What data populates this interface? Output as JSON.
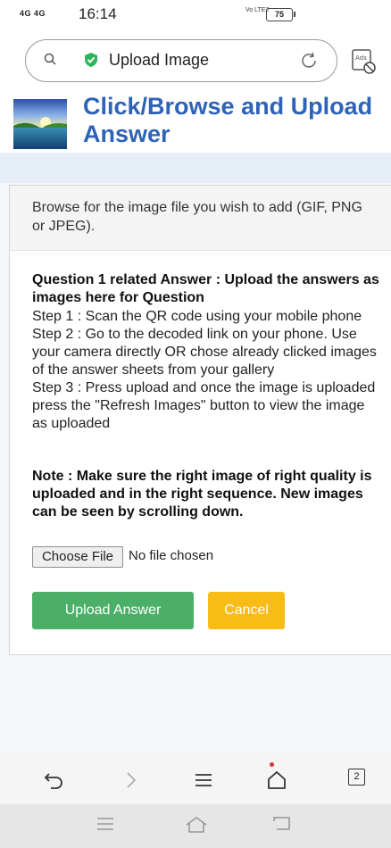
{
  "status_bar": {
    "signal": "4G 4G",
    "time": "16:14",
    "network": "Vo LTE2",
    "battery": "75"
  },
  "browser": {
    "url_text": "Upload Image",
    "tab_count": "2"
  },
  "page": {
    "title": "Click/Browse and Upload Answer",
    "browse_instruction": "Browse for the image file you wish to add (GIF, PNG or JPEG).",
    "question_title": "Question 1 related Answer : Upload the answers as images here for Question",
    "steps": [
      "Step 1 : Scan the QR code using your mobile phone",
      "Step 2 : Go to the decoded link on your phone. Use your camera directly OR chose already clicked images of the answer sheets from your gallery",
      "Step 3 : Press upload and once the image is uploaded press the \"Refresh Images\" button to view the image as uploaded"
    ],
    "note": "Note : Make sure the right image of right quality is uploaded and in the right sequence. New images can be seen by scrolling down.",
    "file_input": {
      "button_label": "Choose File",
      "status": "No file chosen"
    },
    "upload_button": "Upload Answer",
    "cancel_button": "Cancel"
  },
  "colors": {
    "title": "#2e63b8",
    "upload_button": "#4caf68",
    "cancel_button": "#f9bb16",
    "shield": "#2db35a"
  },
  "icons": {
    "url_bar": [
      "search-icon",
      "shield-check-icon",
      "reload-icon",
      "ads-block-icon"
    ],
    "bottom_nav": [
      "back-icon",
      "forward-icon",
      "menu-icon",
      "home-icon",
      "tabs-icon"
    ],
    "system_nav": [
      "recent-apps-icon",
      "home-icon",
      "back-icon"
    ]
  }
}
